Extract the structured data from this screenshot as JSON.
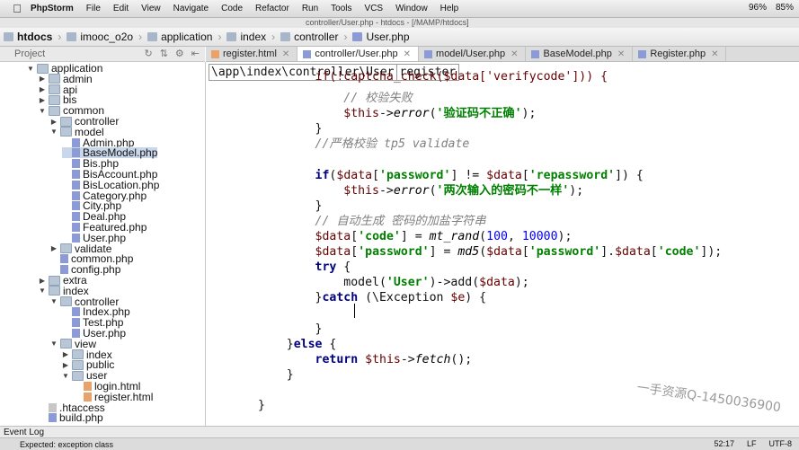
{
  "menubar": {
    "app": "PhpStorm",
    "items": [
      "File",
      "Edit",
      "View",
      "Navigate",
      "Code",
      "Refactor",
      "Run",
      "Tools",
      "VCS",
      "Window",
      "Help"
    ],
    "window_title": "controller/User.php - htdocs - [/MAMP/htdocs]",
    "battery_1": "96%",
    "battery_2": "85%"
  },
  "navbar": {
    "crumbs": [
      "htdocs",
      "imooc_o2o",
      "application",
      "index",
      "controller",
      "User.php"
    ]
  },
  "project_panel": {
    "label": "Project"
  },
  "tabs": [
    {
      "label": "register.html",
      "type": "html"
    },
    {
      "label": "controller/User.php",
      "type": "php",
      "active": true
    },
    {
      "label": "model/User.php",
      "type": "php"
    },
    {
      "label": "BaseModel.php",
      "type": "php"
    },
    {
      "label": "Register.php",
      "type": "php"
    }
  ],
  "tree": [
    {
      "label": "application",
      "depth": 0,
      "kind": "folder",
      "open": true
    },
    {
      "label": "admin",
      "depth": 1,
      "kind": "folder",
      "open": false
    },
    {
      "label": "api",
      "depth": 1,
      "kind": "folder",
      "open": false
    },
    {
      "label": "bis",
      "depth": 1,
      "kind": "folder",
      "open": false
    },
    {
      "label": "common",
      "depth": 1,
      "kind": "folder",
      "open": true
    },
    {
      "label": "controller",
      "depth": 2,
      "kind": "folder",
      "open": false
    },
    {
      "label": "model",
      "depth": 2,
      "kind": "folder",
      "open": true
    },
    {
      "label": "Admin.php",
      "depth": 3,
      "kind": "php"
    },
    {
      "label": "BaseModel.php",
      "depth": 3,
      "kind": "php",
      "selected": true
    },
    {
      "label": "Bis.php",
      "depth": 3,
      "kind": "php"
    },
    {
      "label": "BisAccount.php",
      "depth": 3,
      "kind": "php"
    },
    {
      "label": "BisLocation.php",
      "depth": 3,
      "kind": "php"
    },
    {
      "label": "Category.php",
      "depth": 3,
      "kind": "php"
    },
    {
      "label": "City.php",
      "depth": 3,
      "kind": "php"
    },
    {
      "label": "Deal.php",
      "depth": 3,
      "kind": "php"
    },
    {
      "label": "Featured.php",
      "depth": 3,
      "kind": "php"
    },
    {
      "label": "User.php",
      "depth": 3,
      "kind": "php"
    },
    {
      "label": "validate",
      "depth": 2,
      "kind": "folder",
      "open": false
    },
    {
      "label": "common.php",
      "depth": 2,
      "kind": "php"
    },
    {
      "label": "config.php",
      "depth": 2,
      "kind": "php"
    },
    {
      "label": "extra",
      "depth": 1,
      "kind": "folder",
      "open": false
    },
    {
      "label": "index",
      "depth": 1,
      "kind": "folder",
      "open": true
    },
    {
      "label": "controller",
      "depth": 2,
      "kind": "folder",
      "open": true
    },
    {
      "label": "Index.php",
      "depth": 3,
      "kind": "php"
    },
    {
      "label": "Test.php",
      "depth": 3,
      "kind": "php"
    },
    {
      "label": "User.php",
      "depth": 3,
      "kind": "php"
    },
    {
      "label": "view",
      "depth": 2,
      "kind": "folder",
      "open": true
    },
    {
      "label": "index",
      "depth": 3,
      "kind": "folder",
      "open": false
    },
    {
      "label": "public",
      "depth": 3,
      "kind": "folder",
      "open": false
    },
    {
      "label": "user",
      "depth": 3,
      "kind": "folder",
      "open": true
    },
    {
      "label": "login.html",
      "depth": 4,
      "kind": "html"
    },
    {
      "label": "register.html",
      "depth": 4,
      "kind": "html"
    },
    {
      "label": ".htaccess",
      "depth": 1,
      "kind": "gen"
    },
    {
      "label": "build.php",
      "depth": 1,
      "kind": "php"
    }
  ],
  "editor": {
    "path_prefix": "\\app\\index\\controller\\User",
    "path_query": "register",
    "lines": [
      [
        [
          "        ",
          ""
        ],
        [
          "if(!captcha_check($data['verifycode'])) {",
          "var"
        ]
      ],
      [
        [
          "            ",
          ""
        ],
        [
          "// 校验失败",
          "cm"
        ]
      ],
      [
        [
          "            ",
          ""
        ],
        [
          "$this",
          "var"
        ],
        [
          "->",
          ""
        ],
        [
          "error",
          "fn"
        ],
        [
          "(",
          ""
        ],
        [
          "'验证码不正确'",
          "str"
        ],
        [
          ");",
          ""
        ]
      ],
      [
        [
          "        }",
          ""
        ]
      ],
      [
        [
          "        ",
          ""
        ],
        [
          "//严格校验 tp5 validate",
          "cm"
        ]
      ],
      [
        [
          "",
          ""
        ]
      ],
      [
        [
          "        ",
          ""
        ],
        [
          "if",
          "kw"
        ],
        [
          "(",
          ""
        ],
        [
          "$data",
          "var"
        ],
        [
          "[",
          ""
        ],
        [
          "'password'",
          "str"
        ],
        [
          "] != ",
          ""
        ],
        [
          "$data",
          "var"
        ],
        [
          "[",
          ""
        ],
        [
          "'repassword'",
          "str"
        ],
        [
          "]) {",
          ""
        ]
      ],
      [
        [
          "            ",
          ""
        ],
        [
          "$this",
          "var"
        ],
        [
          "->",
          ""
        ],
        [
          "error",
          "fn"
        ],
        [
          "(",
          ""
        ],
        [
          "'两次输入的密码不一样'",
          "str"
        ],
        [
          ");",
          ""
        ]
      ],
      [
        [
          "        }",
          ""
        ]
      ],
      [
        [
          "        ",
          ""
        ],
        [
          "// 自动生成 密码的加盐字符串",
          "cm"
        ]
      ],
      [
        [
          "        ",
          ""
        ],
        [
          "$data",
          "var"
        ],
        [
          "[",
          ""
        ],
        [
          "'code'",
          "str"
        ],
        [
          "] = ",
          ""
        ],
        [
          "mt_rand",
          "fn"
        ],
        [
          "(",
          ""
        ],
        [
          "100",
          "num"
        ],
        [
          ", ",
          ""
        ],
        [
          "10000",
          "num"
        ],
        [
          ");",
          ""
        ]
      ],
      [
        [
          "        ",
          ""
        ],
        [
          "$data",
          "var"
        ],
        [
          "[",
          ""
        ],
        [
          "'password'",
          "str"
        ],
        [
          "] = ",
          ""
        ],
        [
          "md5",
          "fn"
        ],
        [
          "(",
          ""
        ],
        [
          "$data",
          "var"
        ],
        [
          "[",
          ""
        ],
        [
          "'password'",
          "str"
        ],
        [
          "].",
          ""
        ],
        [
          "$data",
          "var"
        ],
        [
          "[",
          ""
        ],
        [
          "'code'",
          "str"
        ],
        [
          "]);",
          ""
        ]
      ],
      [
        [
          "        ",
          ""
        ],
        [
          "try",
          "kw"
        ],
        [
          " {",
          ""
        ]
      ],
      [
        [
          "            model(",
          ""
        ],
        [
          "'User'",
          "str"
        ],
        [
          ")->add(",
          ""
        ],
        [
          "$data",
          "var"
        ],
        [
          ");",
          ""
        ]
      ],
      [
        [
          "        }",
          ""
        ],
        [
          "catch",
          "kw"
        ],
        [
          " (\\Exception ",
          ""
        ],
        [
          "$e",
          "var"
        ],
        [
          ") {",
          ""
        ]
      ],
      [
        [
          "",
          ""
        ]
      ],
      [
        [
          "        }",
          ""
        ]
      ],
      [
        [
          "    }",
          ""
        ],
        [
          "else",
          "kw"
        ],
        [
          " {",
          ""
        ]
      ],
      [
        [
          "        ",
          ""
        ],
        [
          "return",
          "kw"
        ],
        [
          " ",
          ""
        ],
        [
          "$this",
          "var"
        ],
        [
          "->",
          ""
        ],
        [
          "fetch",
          "fn"
        ],
        [
          "();",
          ""
        ]
      ],
      [
        [
          "    }",
          ""
        ]
      ],
      [
        [
          "",
          ""
        ]
      ],
      [
        [
          "}",
          ""
        ]
      ]
    ]
  },
  "event_log": "Event Log",
  "status": {
    "message": "Expected: exception class",
    "position": "52:17",
    "line_sep": "LF",
    "encoding": "UTF-8"
  },
  "watermark": "一手资源Q-1450036900"
}
